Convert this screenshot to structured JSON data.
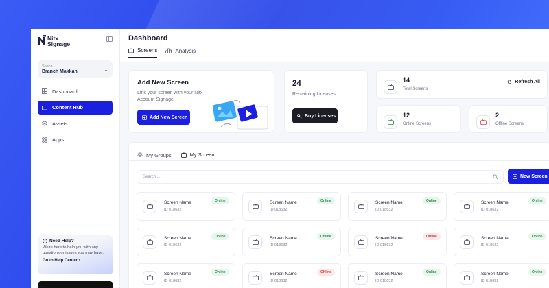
{
  "brand": {
    "line1": "Nitx",
    "line2": "Signage"
  },
  "space": {
    "label": "Space",
    "value": "Branch Makkah"
  },
  "nav": [
    {
      "label": "Dashboard",
      "icon": "grid-icon"
    },
    {
      "label": "Content Hub",
      "icon": "folder-icon",
      "active": true
    },
    {
      "label": "Assets",
      "icon": "layers-icon"
    },
    {
      "label": "Apps",
      "icon": "apps-icon"
    }
  ],
  "help": {
    "title": "Need Help?",
    "text": "We're here to help you with any questions or issues you may have.",
    "link": "Go to Help Center"
  },
  "header": {
    "title": "Dashboard"
  },
  "tabs": [
    {
      "label": "Screens",
      "active": true
    },
    {
      "label": "Analysis",
      "active": false
    }
  ],
  "add_card": {
    "title": "Add New Screen",
    "subtitle": "Link your screen with your Nitx Account Signage",
    "button": "Add New Screen"
  },
  "licenses": {
    "count": "24",
    "label": "Remaining Licenses",
    "button": "Buy Licenses"
  },
  "stats": {
    "total": {
      "value": "14",
      "label": "Total Screens"
    },
    "online": {
      "value": "12",
      "label": "Online Screens"
    },
    "offline": {
      "value": "2",
      "label": "Offline Screens"
    },
    "refresh": "Refresh All"
  },
  "list": {
    "tabs": [
      {
        "label": "My Groups",
        "active": false
      },
      {
        "label": "My Screen",
        "active": true
      }
    ],
    "search_placeholder": "Search ...",
    "new_button": "New Screen",
    "screens": [
      {
        "name": "Screen Name",
        "id": "ID 018632",
        "status": "Online"
      },
      {
        "name": "Screen Name",
        "id": "ID 018632",
        "status": "Online"
      },
      {
        "name": "Screen Name",
        "id": "ID 018632",
        "status": "Online"
      },
      {
        "name": "Screen Name",
        "id": "ID 018632",
        "status": "Online"
      },
      {
        "name": "Screen Name",
        "id": "ID 018632",
        "status": "Online"
      },
      {
        "name": "Screen Name",
        "id": "ID 018632",
        "status": "Online"
      },
      {
        "name": "Screen Name",
        "id": "ID 018632",
        "status": "Offline"
      },
      {
        "name": "Screen Name",
        "id": "ID 018632",
        "status": "Online"
      },
      {
        "name": "Screen Name",
        "id": "ID 018632",
        "status": "Online"
      },
      {
        "name": "Screen Name",
        "id": "ID 018632",
        "status": "Offline"
      },
      {
        "name": "Screen Name",
        "id": "ID 018632",
        "status": "Online"
      },
      {
        "name": "Screen Name",
        "id": "ID 018632",
        "status": "Online"
      }
    ]
  },
  "colors": {
    "accent": "#1a1fe0",
    "online": "#2f8a4e",
    "offline": "#d14343",
    "dark_button": "#1d1d26"
  }
}
